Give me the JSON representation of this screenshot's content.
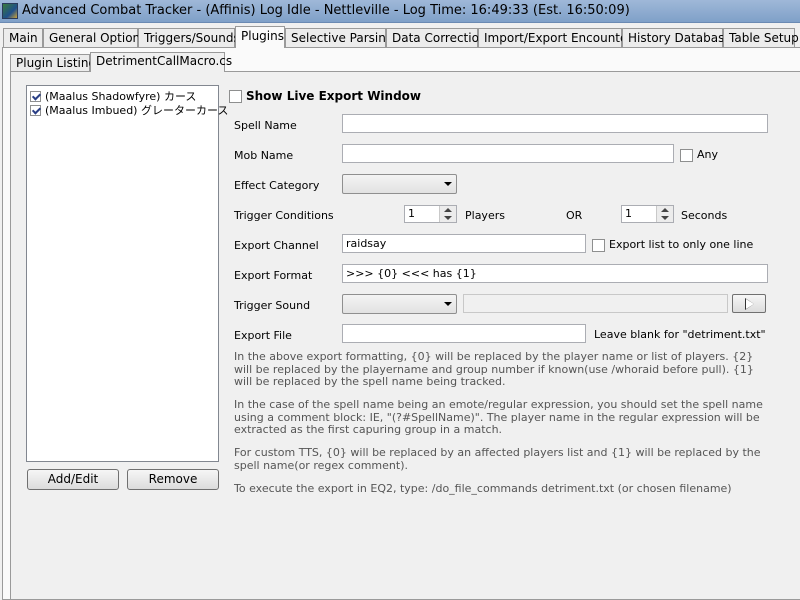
{
  "window": {
    "title": "Advanced Combat Tracker - (Affinis) Log Idle - Nettleville - Log Time: 16:49:33 (Est. 16:50:09)",
    "icon": "act-app-icon"
  },
  "main_tabs": [
    {
      "label": "Main"
    },
    {
      "label": "General Options"
    },
    {
      "label": "Triggers/Sounds"
    },
    {
      "label": "Plugins",
      "active": true
    },
    {
      "label": "Selective Parsing"
    },
    {
      "label": "Data Correction"
    },
    {
      "label": "Import/Export Encounters"
    },
    {
      "label": "History Database"
    },
    {
      "label": "Table Setup"
    }
  ],
  "sub_tabs": [
    {
      "label": "Plugin Listing"
    },
    {
      "label": "DetrimentCallMacro.cs",
      "active": true
    }
  ],
  "macro_list": {
    "items": [
      {
        "label": "(Maalus Shadowfyre) カース",
        "checked": true
      },
      {
        "label": "(Maalus Imbued) グレーターカース",
        "checked": true
      }
    ],
    "add_edit_label": "Add/Edit",
    "remove_label": "Remove"
  },
  "form": {
    "show_live_export_label": "Show Live Export Window",
    "show_live_export_checked": false,
    "spell_name_label": "Spell Name",
    "spell_name_value": "",
    "mob_name_label": "Mob Name",
    "mob_name_value": "",
    "any_label": "Any",
    "any_checked": false,
    "effect_category_label": "Effect Category",
    "effect_category_value": "",
    "trigger_conditions_label": "Trigger Conditions",
    "players_count": "1",
    "players_label": "Players",
    "or_label": "OR",
    "seconds_count": "1",
    "seconds_label": "Seconds",
    "export_channel_label": "Export Channel",
    "export_channel_value": "raidsay",
    "export_one_line_label": "Export list to only one line",
    "export_one_line_checked": false,
    "export_format_label": "Export Format",
    "export_format_value": ">>> {0} <<< has {1}",
    "trigger_sound_label": "Trigger Sound",
    "trigger_sound_value": "",
    "sound_path_value": "",
    "export_file_label": "Export File",
    "export_file_value": "",
    "leave_blank_label": "Leave blank for \"detriment.txt\""
  },
  "help": {
    "p1": "In the above export formatting, {0} will be replaced by the player name or list of players. {2} will be replaced by the playername and group number if known(use /whoraid before pull).  {1} will be replaced by the spell name being tracked.",
    "p2": "In the case of the spell name being an emote/regular expression, you should set the spell name using a comment block: IE, \"(?#SpellName)\".  The player name in the regular expression will be extracted as the first capuring group in a match.",
    "p3": "For custom TTS, {0} will be replaced by an affected players list and {1} will be replaced by the spell name(or regex comment).",
    "p4": "To execute the export in EQ2, type: /do_file_commands detriment.txt   (or chosen filename)"
  }
}
